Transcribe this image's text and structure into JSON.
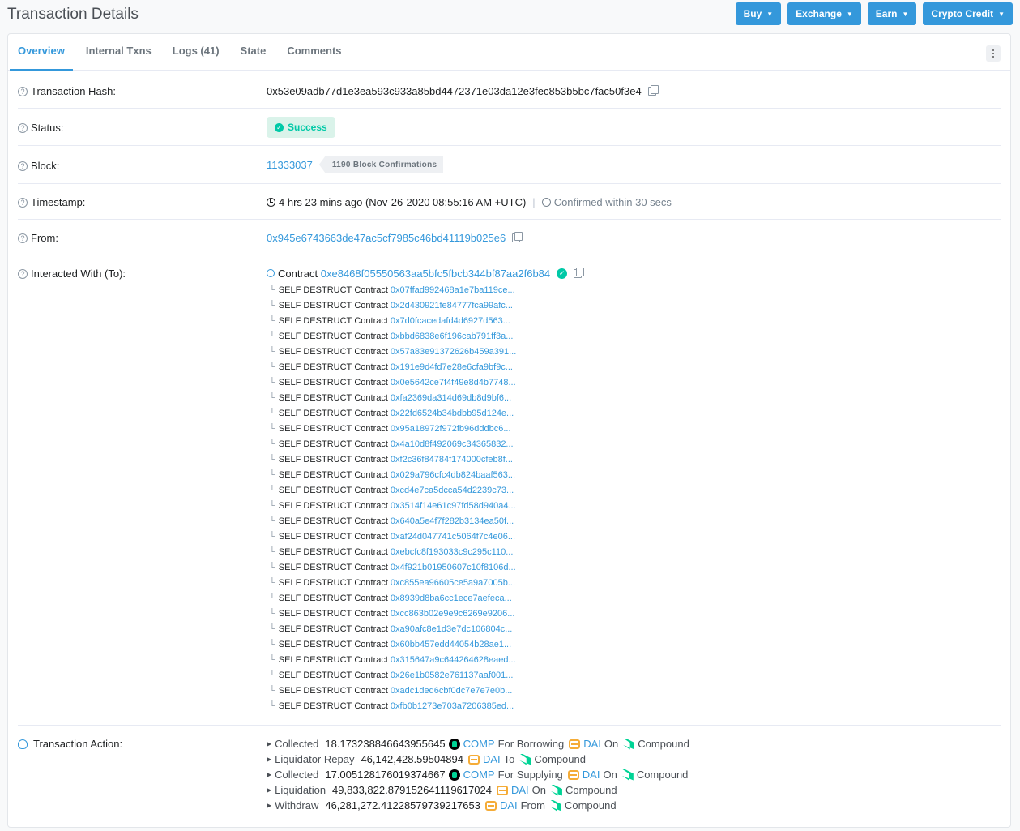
{
  "page": {
    "title": "Transaction Details"
  },
  "top_buttons": [
    {
      "label": "Buy"
    },
    {
      "label": "Exchange"
    },
    {
      "label": "Earn"
    },
    {
      "label": "Crypto Credit"
    }
  ],
  "tabs": [
    {
      "label": "Overview",
      "active": true
    },
    {
      "label": "Internal Txns"
    },
    {
      "label": "Logs (41)"
    },
    {
      "label": "State"
    },
    {
      "label": "Comments"
    }
  ],
  "overview": {
    "tx_hash": {
      "label": "Transaction Hash:",
      "value": "0x53e09adb77d1e3ea593c933a85bd4472371e03da12e3fec853b5bc7fac50f3e4"
    },
    "status": {
      "label": "Status:",
      "value": "Success"
    },
    "block": {
      "label": "Block:",
      "value": "11333037",
      "confirmations": "1190 Block Confirmations"
    },
    "timestamp": {
      "label": "Timestamp:",
      "age": "4 hrs 23 mins ago (Nov-26-2020 08:55:16 AM +UTC)",
      "confirmed": "Confirmed within 30 secs"
    },
    "from": {
      "label": "From:",
      "value": "0x945e6743663de47ac5cf7985c46bd41119b025e6"
    },
    "to": {
      "label": "Interacted With (To):",
      "contract_word": "Contract",
      "contract": "0xe8468f05550563aa5bfc5fbcb344bf87aa2f6b84",
      "self_destruct_label": "SELF DESTRUCT",
      "self_destructs": [
        "0x07ffad992468a1e7ba119ce...",
        "0x2d430921fe84777fca99afc...",
        "0x7d0fcacedafd4d6927d563...",
        "0xbbd6838e6f196cab791ff3a...",
        "0x57a83e91372626b459a391...",
        "0x191e9d4fd7e28e6cfa9bf9c...",
        "0x0e5642ce7f4f49e8d4b7748...",
        "0xfa2369da314d69db8d9bf6...",
        "0x22fd6524b34bdbb95d124e...",
        "0x95a18972f972fb96dddbc6...",
        "0x4a10d8f492069c34365832...",
        "0xf2c36f84784f174000cfeb8f...",
        "0x029a796cfc4db824baaf563...",
        "0xcd4e7ca5dcca54d2239c73...",
        "0x3514f14e61c97fd58d940a4...",
        "0x640a5e4f7f282b3134ea50f...",
        "0xaf24d047741c5064f7c4e06...",
        "0xebcfc8f193033c9c295c110...",
        "0x4f921b01950607c10f8106d...",
        "0xc855ea96605ce5a9a7005b...",
        "0x8939d8ba6cc1ece7aefeca...",
        "0xcc863b02e9e9c6269e9206...",
        "0xa90afc8e1d3e7dc106804c...",
        "0x60bb457edd44054b28ae1...",
        "0x315647a9c644264628eaed...",
        "0x26e1b0582e761137aaf001...",
        "0xadc1ded6cbf0dc7e7e7e0b...",
        "0xfb0b1273e703a7206385ed..."
      ]
    },
    "action": {
      "label": "Transaction Action:",
      "lines": [
        {
          "parts": [
            [
              "Collected",
              "w"
            ],
            [
              "18.173238846643955645",
              "num"
            ],
            [
              "comp-icon",
              "comp"
            ],
            [
              "COMP",
              "link"
            ],
            [
              "For Borrowing",
              "w"
            ],
            [
              "dai-icon",
              "dai"
            ],
            [
              "DAI",
              "link"
            ],
            [
              "On",
              "w"
            ],
            [
              "compound-icon",
              "cmp"
            ],
            [
              "Compound",
              "w"
            ]
          ]
        },
        {
          "parts": [
            [
              "Liquidator Repay",
              "w"
            ],
            [
              "46,142,428.59504894",
              "num"
            ],
            [
              "dai-icon",
              "dai"
            ],
            [
              "DAI",
              "link"
            ],
            [
              "To",
              "w"
            ],
            [
              "compound-icon",
              "cmp"
            ],
            [
              "Compound",
              "w"
            ]
          ]
        },
        {
          "parts": [
            [
              "Collected",
              "w"
            ],
            [
              "17.005128176019374667",
              "num"
            ],
            [
              "comp-icon",
              "comp"
            ],
            [
              "COMP",
              "link"
            ],
            [
              "For Supplying",
              "w"
            ],
            [
              "dai-icon",
              "dai"
            ],
            [
              "DAI",
              "link"
            ],
            [
              "On",
              "w"
            ],
            [
              "compound-icon",
              "cmp"
            ],
            [
              "Compound",
              "w"
            ]
          ]
        },
        {
          "parts": [
            [
              "Liquidation",
              "w"
            ],
            [
              "49,833,822.879152641119617024",
              "num"
            ],
            [
              "dai-icon",
              "dai"
            ],
            [
              "DAI",
              "link"
            ],
            [
              "On",
              "w"
            ],
            [
              "compound-icon",
              "cmp"
            ],
            [
              "Compound",
              "w"
            ]
          ]
        },
        {
          "parts": [
            [
              "Withdraw",
              "w"
            ],
            [
              "46,281,272.41228579739217653",
              "num"
            ],
            [
              "dai-icon",
              "dai"
            ],
            [
              "DAI",
              "link"
            ],
            [
              "From",
              "w"
            ],
            [
              "compound-icon",
              "cmp"
            ],
            [
              "Compound",
              "w"
            ]
          ]
        }
      ]
    }
  }
}
